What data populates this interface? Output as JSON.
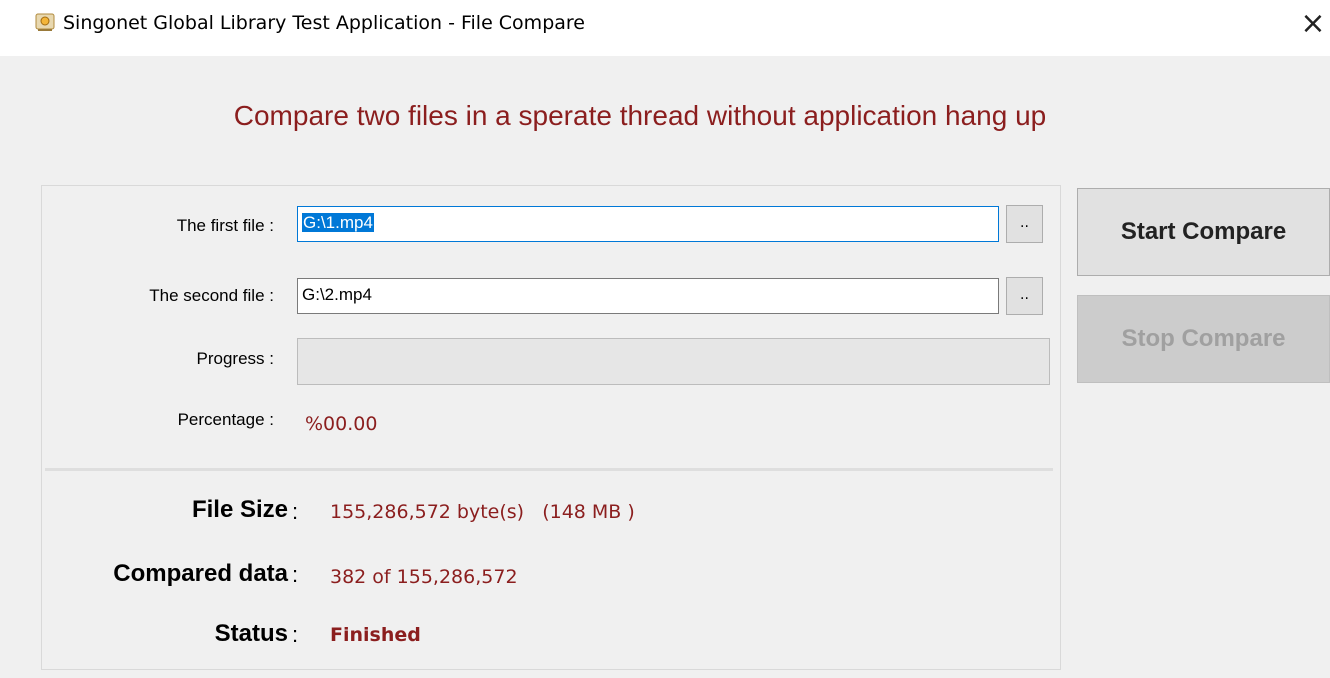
{
  "window": {
    "title": "Singonet Global Library Test Application - File Compare",
    "close_glyph": "×",
    "icon": "app-icon"
  },
  "headline": "Compare two files in a sperate thread without application hang up",
  "form": {
    "first_file_label": "The first file :",
    "first_file_value": "G:\\1.mp4",
    "second_file_label": "The second file :",
    "second_file_value": "G:\\2.mp4",
    "browse_label": "..",
    "progress_label": "Progress :",
    "progress_value": 0,
    "percentage_label": "Percentage :",
    "percentage_value": "%00.00"
  },
  "info": {
    "file_size_label": "File Size",
    "file_size_value": "155,286,572 byte(s)   (148 MB )",
    "compared_label": "Compared data",
    "compared_value": "382 of 155,286,572",
    "status_label": "Status",
    "status_value": "Finished",
    "colon": ":"
  },
  "buttons": {
    "start": "Start Compare",
    "stop": "Stop Compare"
  },
  "colors": {
    "accent_text": "#8b1e1e",
    "selection": "#0078d7"
  }
}
